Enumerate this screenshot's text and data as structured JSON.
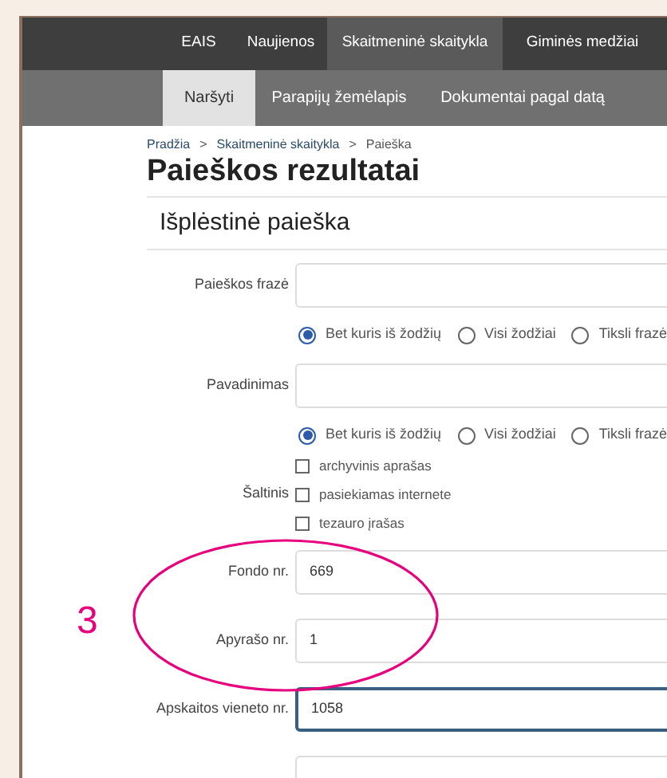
{
  "nav": {
    "items": [
      {
        "label": "EAIS",
        "selected": false
      },
      {
        "label": "Naujienos",
        "selected": false
      },
      {
        "label": "Skaitmeninė skaitykla",
        "selected": true
      },
      {
        "label": "Giminės medžiai",
        "selected": false
      }
    ]
  },
  "subnav": {
    "items": [
      {
        "label": "Naršyti",
        "selected": true
      },
      {
        "label": "Parapijų žemėlapis",
        "selected": false
      },
      {
        "label": "Dokumentai pagal datą",
        "selected": false
      }
    ]
  },
  "breadcrumb": {
    "separator": ">",
    "items": [
      "Pradžia",
      "Skaitmeninė skaitykla",
      "Paieška"
    ]
  },
  "title": "Paieškos rezultatai",
  "section_title": "Išplėstinė paieška",
  "form": {
    "fields": [
      {
        "kind": "text",
        "label": "Paieškos frazė",
        "focused": false
      },
      {
        "kind": "radios",
        "options": [
          {
            "label": "Bet kuris iš žodžių",
            "selected": true
          },
          {
            "label": "Visi žodžiai",
            "selected": false
          },
          {
            "label": "Tiksli frazė",
            "selected": false
          }
        ]
      },
      {
        "kind": "text",
        "label": "Pavadinimas",
        "focused": false
      },
      {
        "kind": "radios",
        "options": [
          {
            "label": "Bet kuris iš žodžių",
            "selected": true
          },
          {
            "label": "Visi žodžiai",
            "selected": false
          },
          {
            "label": "Tiksli frazė",
            "selected": false
          }
        ]
      },
      {
        "kind": "checks",
        "label": "Šaltinis",
        "options": [
          {
            "label": "archyvinis aprašas",
            "checked": false
          },
          {
            "label": "pasiekiamas internete",
            "checked": false
          },
          {
            "label": "tezauro įrašas",
            "checked": false
          }
        ]
      },
      {
        "kind": "text",
        "label": "Fondo nr.",
        "value": "669",
        "focused": false
      },
      {
        "kind": "text",
        "label": "Apyrašo nr.",
        "value": "1",
        "focused": false
      },
      {
        "kind": "text",
        "label": "Apskaitos vieneto nr.",
        "value": "1058",
        "focused": true
      },
      {
        "kind": "text",
        "focused": false
      }
    ]
  },
  "annotation": {
    "number": "3"
  }
}
